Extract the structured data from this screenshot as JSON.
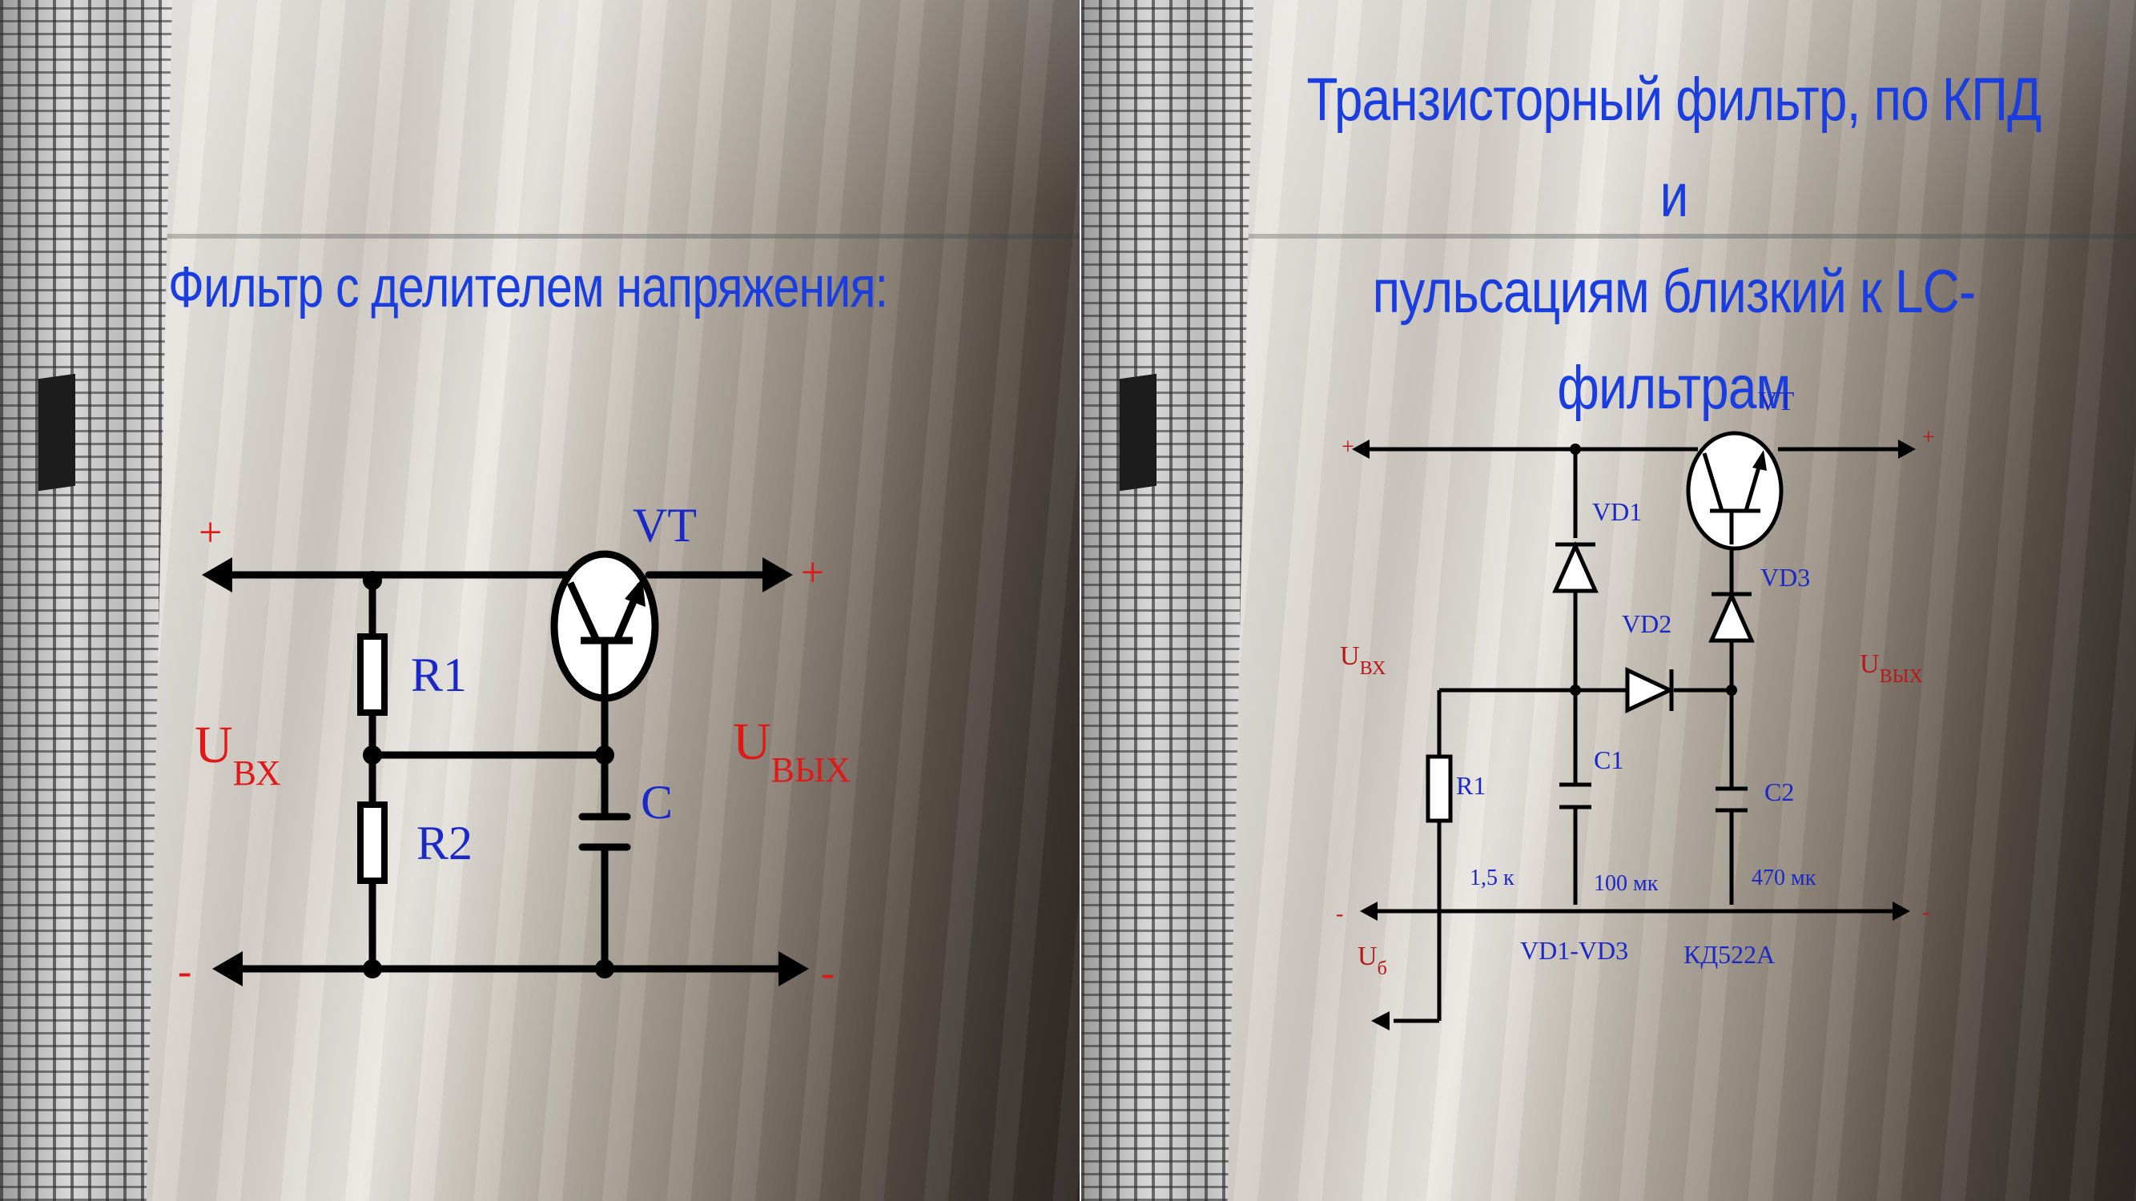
{
  "left_slide": {
    "title": "Фильтр с делителем напряжения:",
    "labels": {
      "plus_in": "+",
      "plus_out": "+",
      "minus_in": "-",
      "minus_out": "-",
      "transistor": "VT",
      "r1": "R1",
      "r2": "R2",
      "capacitor": "C",
      "u_in_main": "U",
      "u_in_sub": "ВХ",
      "u_out_main": "U",
      "u_out_sub": "ВЫХ"
    }
  },
  "right_slide": {
    "title_line1": "Транзисторный фильтр, по КПД и",
    "title_line2": "пульсациям близкий к LC-",
    "title_line3": "фильтрам",
    "labels": {
      "plus_in": "+",
      "plus_out": "+",
      "minus_in": "-",
      "minus_out": "-",
      "transistor": "VT",
      "vd1": "VD1",
      "vd2": "VD2",
      "vd3": "VD3",
      "r1": "R1",
      "c1": "C1",
      "c2": "C2",
      "r1_value": "1,5 к",
      "c1_value": "100 мк",
      "c2_value": "470 мк",
      "diodes_range": "VD1-VD3",
      "diodes_type": "КД522А",
      "u_in_main": "U",
      "u_in_sub": "ВХ",
      "u_out_main": "U",
      "u_out_sub": "ВЫХ",
      "u_b_main": "U",
      "u_b_sub": "б"
    }
  },
  "colors": {
    "title_blue": "#1a3de0",
    "label_blue": "#1a28c8",
    "label_red": "#e01818",
    "wire": "#000000"
  }
}
